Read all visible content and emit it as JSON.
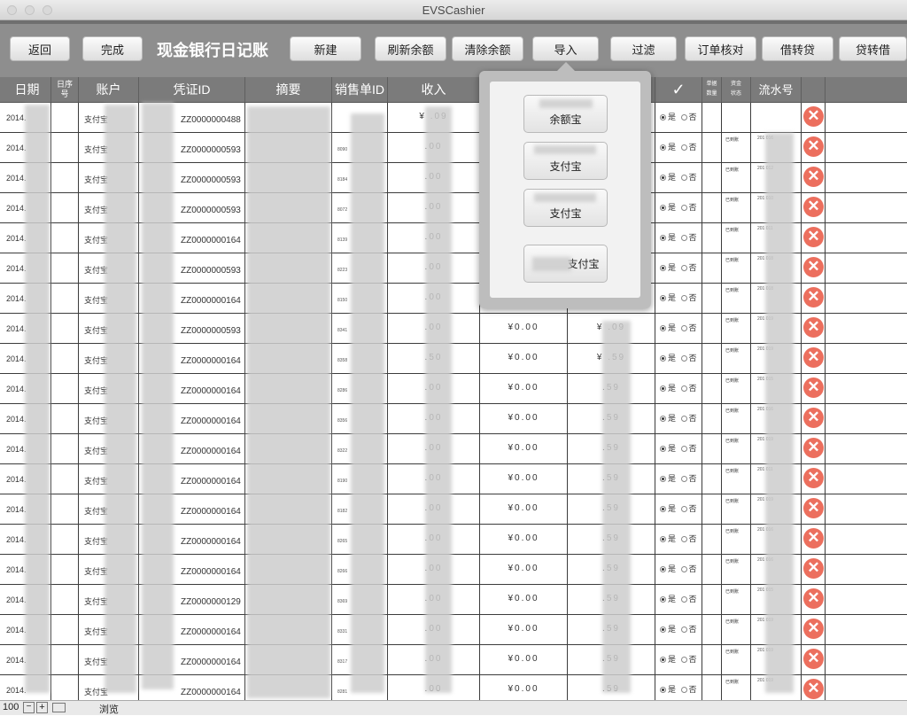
{
  "window": {
    "title": "EVSCashier"
  },
  "toolbar": {
    "back": "返回",
    "done": "完成",
    "page_title": "现金银行日记账",
    "new": "新建",
    "refresh_balance": "刷新余额",
    "clear_balance": "清除余额",
    "import": "导入",
    "filter": "过滤",
    "order_check": "订单核对",
    "debit_to_credit": "借转贷",
    "credit_to_debit": "贷转借"
  },
  "columns": {
    "date": "日期",
    "index_a": "日序",
    "index_b": "号",
    "account": "账户",
    "voucher": "凭证ID",
    "memo": "摘要",
    "sales_id": "销售单ID",
    "income": "收入",
    "check": "✓",
    "qty_a": "单据",
    "qty_b": "数量",
    "status_a": "资金",
    "status_b": "状态",
    "flow": "流水号"
  },
  "import_popover": {
    "items": [
      {
        "label": "余额宝"
      },
      {
        "label": "支付宝"
      },
      {
        "label": "支付宝"
      },
      {
        "label": "支付宝"
      }
    ]
  },
  "yes_label": "是",
  "no_label": "否",
  "rows": [
    {
      "date": "2014.",
      "account": "支付宝",
      "voucher": "ZZ0000000488",
      "sale": "",
      "income": "¥ .09",
      "expense": "",
      "balance": "",
      "status": "",
      "flow": ""
    },
    {
      "date": "2014.",
      "account": "支付宝",
      "voucher": "ZZ0000000593",
      "sale": "8090",
      "income": ".00",
      "expense": "",
      "balance": "",
      "status": "已到账",
      "flow": "201 016"
    },
    {
      "date": "2014.",
      "account": "支付宝",
      "voucher": "ZZ0000000593",
      "sale": "8184",
      "income": ".00",
      "expense": "",
      "balance": "",
      "status": "已到账",
      "flow": "201 012"
    },
    {
      "date": "2014.",
      "account": "支付宝",
      "voucher": "ZZ0000000593",
      "sale": "8072",
      "income": ".00",
      "expense": "",
      "balance": "",
      "status": "已到账",
      "flow": "201 010"
    },
    {
      "date": "2014.",
      "account": "支付宝",
      "voucher": "ZZ0000000164",
      "sale": "8139",
      "income": ".00",
      "expense": "",
      "balance": "",
      "status": "已到账",
      "flow": "201 011"
    },
    {
      "date": "2014.",
      "account": "支付宝",
      "voucher": "ZZ0000000593",
      "sale": "8223",
      "income": ".00",
      "expense": "",
      "balance": "",
      "status": "已到账",
      "flow": "201 018"
    },
    {
      "date": "2014.",
      "account": "支付宝",
      "voucher": "ZZ0000000164",
      "sale": "8150",
      "income": ".00",
      "expense": "",
      "balance": "",
      "status": "已到账",
      "flow": "201 018"
    },
    {
      "date": "2014.",
      "account": "支付宝",
      "voucher": "ZZ0000000593",
      "sale": "8341",
      "income": ".00",
      "expense": "¥0.00",
      "balance": "¥ .09",
      "status": "已到账",
      "flow": "201 019"
    },
    {
      "date": "2014.",
      "account": "支付宝",
      "voucher": "ZZ0000000164",
      "sale": "8358",
      "income": ".50",
      "expense": "¥0.00",
      "balance": "¥ .59",
      "status": "已到账",
      "flow": "201 019"
    },
    {
      "date": "2014.",
      "account": "支付宝",
      "voucher": "ZZ0000000164",
      "sale": "8286",
      "income": ".00",
      "expense": "¥0.00",
      "balance": ".59",
      "status": "已到账",
      "flow": "201 015"
    },
    {
      "date": "2014.",
      "account": "支付宝",
      "voucher": "ZZ0000000164",
      "sale": "8356",
      "income": ".00",
      "expense": "¥0.00",
      "balance": ".59",
      "status": "已到账",
      "flow": "201 016"
    },
    {
      "date": "2014.",
      "account": "支付宝",
      "voucher": "ZZ0000000164",
      "sale": "8322",
      "income": ".00",
      "expense": "¥0.00",
      "balance": ".59",
      "status": "已到账",
      "flow": "201 019"
    },
    {
      "date": "2014.",
      "account": "支付宝",
      "voucher": "ZZ0000000164",
      "sale": "8190",
      "income": ".00",
      "expense": "¥0.00",
      "balance": ".59",
      "status": "已到账",
      "flow": "201 011"
    },
    {
      "date": "2014.",
      "account": "支付宝",
      "voucher": "ZZ0000000164",
      "sale": "8182",
      "income": ".00",
      "expense": "¥0.00",
      "balance": ".59",
      "status": "已到账",
      "flow": "201 019"
    },
    {
      "date": "2014.",
      "account": "支付宝",
      "voucher": "ZZ0000000164",
      "sale": "8265",
      "income": ".00",
      "expense": "¥0.00",
      "balance": ".59",
      "status": "已到账",
      "flow": "201 016"
    },
    {
      "date": "2014.",
      "account": "支付宝",
      "voucher": "ZZ0000000164",
      "sale": "8266",
      "income": ".00",
      "expense": "¥0.00",
      "balance": ".59",
      "status": "已到账",
      "flow": "201 016"
    },
    {
      "date": "2014.",
      "account": "支付宝",
      "voucher": "ZZ0000000129",
      "sale": "8369",
      "income": ".00",
      "expense": "¥0.00",
      "balance": ".59",
      "status": "已到账",
      "flow": "201 015"
    },
    {
      "date": "2014.",
      "account": "支付宝",
      "voucher": "ZZ0000000164",
      "sale": "8331",
      "income": ".00",
      "expense": "¥0.00",
      "balance": ".59",
      "status": "已到账",
      "flow": "201 019"
    },
    {
      "date": "2014.",
      "account": "支付宝",
      "voucher": "ZZ0000000164",
      "sale": "8317",
      "income": ".00",
      "expense": "¥0.00",
      "balance": ".59",
      "status": "已到账",
      "flow": "201 019"
    },
    {
      "date": "2014.",
      "account": "支付宝",
      "voucher": "ZZ0000000164",
      "sale": "8281",
      "income": ".00",
      "expense": "¥0.00",
      "balance": ".59",
      "status": "已到账",
      "flow": "201 019"
    }
  ],
  "statusbar": {
    "zoom": "100",
    "mode": "浏览"
  }
}
